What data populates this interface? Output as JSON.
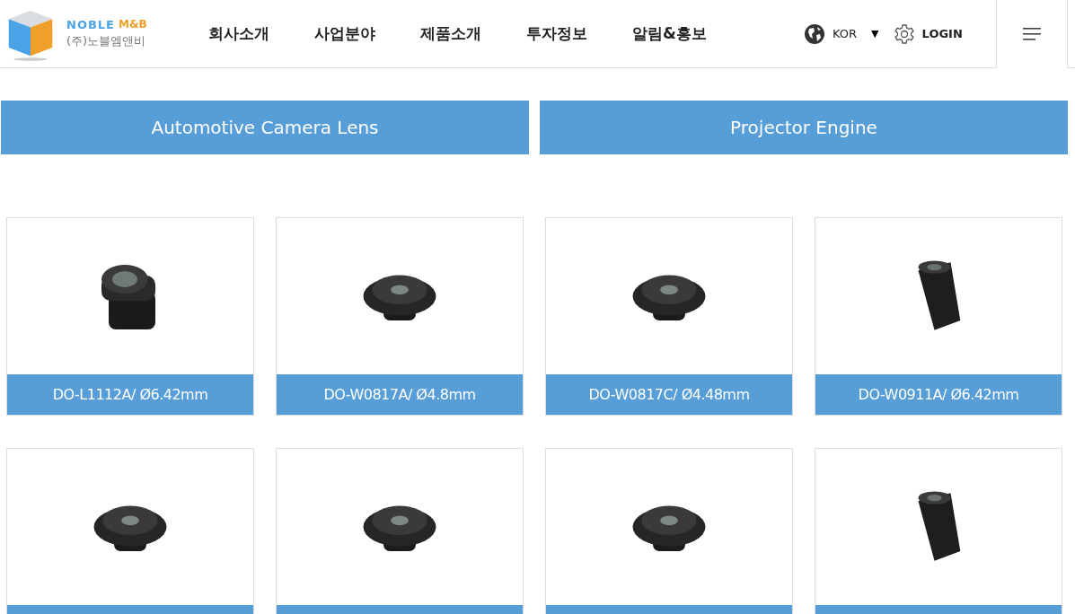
{
  "brand": {
    "name": "NOBLE",
    "suffix": "M&B",
    "korean": "(주)노블엠앤비"
  },
  "nav": [
    "회사소개",
    "사업분야",
    "제품소개",
    "투자정보",
    "알림&홍보"
  ],
  "language": {
    "label": "KOR",
    "caret": "▼"
  },
  "login": "LOGIN",
  "categories": [
    "Automotive Camera Lens",
    "Projector Engine"
  ],
  "products": [
    {
      "name": "DO-L1112A/ Ø6.42mm",
      "kind": "stack"
    },
    {
      "name": "DO-W0817A/ Ø4.8mm",
      "kind": "flat"
    },
    {
      "name": "DO-W0817C/ Ø4.48mm",
      "kind": "flat"
    },
    {
      "name": "DO-W0911A/ Ø6.42mm",
      "kind": "barrel"
    },
    {
      "kind": "flat"
    },
    {
      "kind": "flat"
    },
    {
      "kind": "flat"
    },
    {
      "kind": "barrel"
    }
  ]
}
